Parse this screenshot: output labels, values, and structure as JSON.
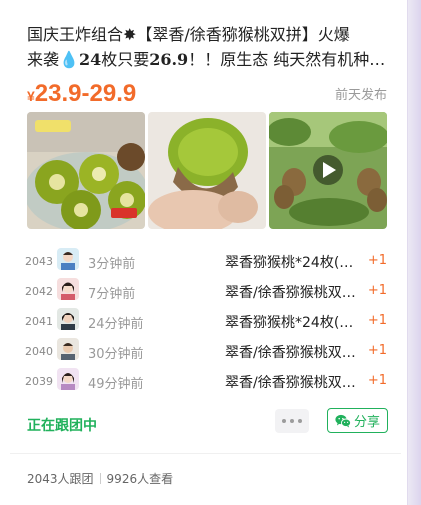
{
  "post": {
    "title_line1": "国庆王炸组合✸【翠香/徐香猕猴桃双拼】火爆",
    "title_line2_a": "来袭💧",
    "title_line2_b": "24",
    "title_line2_c": "枚只要",
    "title_line2_d": "26.9",
    "title_line2_e": "！！原生态 纯天然有机种…",
    "price_symbol": "¥",
    "price_range": "23.9-29.9",
    "posted_time": "前天发布",
    "photos": [
      {
        "icon": "kiwi-halves-photo"
      },
      {
        "icon": "kiwi-peeled-photo"
      },
      {
        "icon": "kiwi-orchard-video",
        "is_video": true
      }
    ]
  },
  "orders": [
    {
      "no": "2043",
      "ago": "3分钟前",
      "item": "翠香猕猴桃*24枚(…",
      "qty": "+1"
    },
    {
      "no": "2042",
      "ago": "7分钟前",
      "item": "翠香/徐香猕猴桃双…",
      "qty": "+1"
    },
    {
      "no": "2041",
      "ago": "24分钟前",
      "item": "翠香猕猴桃*24枚(…",
      "qty": "+1"
    },
    {
      "no": "2040",
      "ago": "30分钟前",
      "item": "翠香/徐香猕猴桃双…",
      "qty": "+1"
    },
    {
      "no": "2039",
      "ago": "49分钟前",
      "item": "翠香/徐香猕猴桃双…",
      "qty": "+1"
    }
  ],
  "status": {
    "label": "正在跟团中",
    "share_label": "分享"
  },
  "footer": {
    "followers": "2043人跟团",
    "views": "9926人查看"
  },
  "colors": {
    "accent_orange": "#f26b2a",
    "accent_green": "#21b15c"
  }
}
